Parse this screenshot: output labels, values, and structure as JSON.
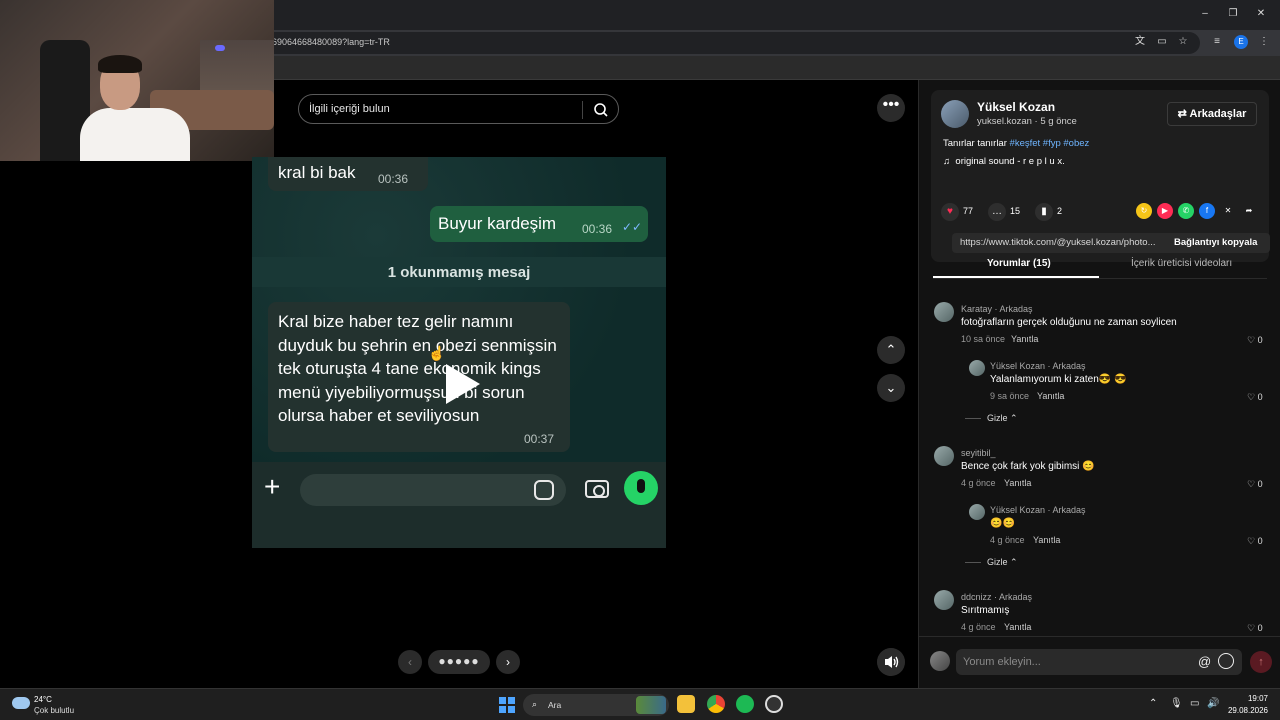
{
  "browser": {
    "url": "69064668480089?lang=tr-TR",
    "profile_initial": "E"
  },
  "search": {
    "placeholder": "İlgili içeriği bulun"
  },
  "chat_photo": {
    "msg_top": "kral bi bak",
    "msg_top_time": "00:36",
    "msg_out": "Buyur kardeşim",
    "msg_out_time": "00:36",
    "unread_label": "1 okunmamış mesaj",
    "msg_main": "Kral bize haber tez gelir namını duyduk bu şehrin en obezi senmişsin tek oturuşta 4 tane ekonomik kings menü yiyebiliyormuşsun bi sorun olursa haber et seviliyosun",
    "msg_main_time": "00:37"
  },
  "author": {
    "name": "Yüksel Kozan",
    "sub": "yuksel.kozan · 5 g önce",
    "friends_label": "Arkadaşlar",
    "desc_text": "Tanırlar tanırlar ",
    "desc_tags": "#keşfet #fyp #obez",
    "sound": "original sound - r e p l u x."
  },
  "stats": {
    "likes": "77",
    "comments": "15",
    "saves": "2"
  },
  "link": {
    "url": "https://www.tiktok.com/@yuksel.kozan/photo...",
    "copy_label": "Bağlantıyı kopyala"
  },
  "tabs": {
    "comments": "Yorumlar (15)",
    "creator_videos": "İçerik üreticisi videoları"
  },
  "comments": [
    {
      "user": "Karatay · Arkadaş",
      "text": "fotoğrafların gerçek olduğunu ne zaman soylicen",
      "time": "10 sa önce",
      "reply": "Yanıtla",
      "likes": "0"
    },
    {
      "user": "Yüksel Kozan · Arkadaş",
      "text": "Yalanlamıyorum ki zaten😎 😎",
      "time": "9 sa önce",
      "reply": "Yanıtla",
      "likes": "0"
    },
    {
      "user": "seyitibil_",
      "text": "Bence çok fark yok gibimsi 😊",
      "time": "4 g önce",
      "reply": "Yanıtla",
      "likes": "0"
    },
    {
      "user": "Yüksel Kozan · Arkadaş",
      "text": "😊😊",
      "time": "4 g önce",
      "reply": "Yanıtla",
      "likes": "0"
    },
    {
      "user": "ddcnizz · Arkadaş",
      "text": "Sırıtmamış",
      "time": "4 g önce",
      "reply": "Yanıtla",
      "likes": "0"
    }
  ],
  "hide_label": "Gizle",
  "comment_input": {
    "placeholder": "Yorum ekleyin..."
  },
  "taskbar": {
    "temp": "24°C",
    "condition": "Çok bulutlu",
    "search_placeholder": "Ara",
    "time": "19:07",
    "date": "29.08.2026"
  },
  "icons": {
    "search": "search-icon",
    "more": "more-icon",
    "play": "play-icon",
    "volume": "volume-icon",
    "heart": "heart-icon",
    "comment": "comment-icon",
    "bookmark": "bookmark-icon"
  }
}
